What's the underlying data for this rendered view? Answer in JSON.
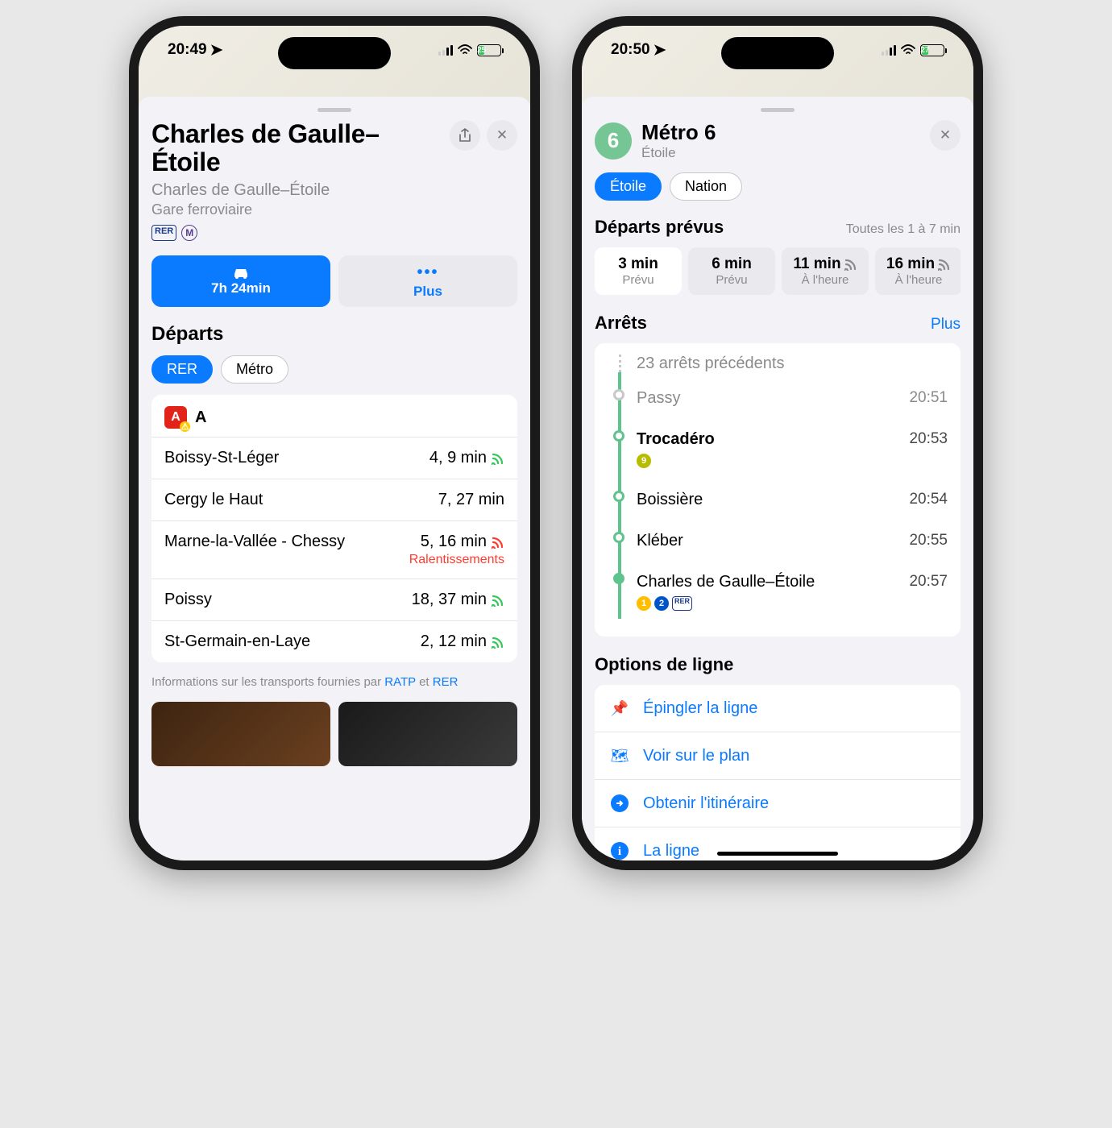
{
  "colors": {
    "accent": "#0a7aff",
    "green_line": "#5fc38e",
    "line6": "#76c695",
    "rer_a": "#e2231a",
    "warn": "#ff3b30"
  },
  "left": {
    "status": {
      "time": "20:49",
      "battery": "25"
    },
    "title": "Charles de Gaulle–Étoile",
    "subtitle_area": "Charles de Gaulle–Étoile",
    "subtitle_type": "Gare ferroviaire",
    "icons": {
      "rer": "RER",
      "metro": "M"
    },
    "actions": {
      "drive_time": "7h 24min",
      "more": "Plus"
    },
    "departures_label": "Départs",
    "tabs": {
      "rer": "RER",
      "metro": "Métro"
    },
    "line": {
      "badge": "A",
      "name": "A"
    },
    "destinations": [
      {
        "name": "Boissy-St-Léger",
        "eta": "4, 9 min",
        "live": true
      },
      {
        "name": "Cergy le Haut",
        "eta": "7, 27 min",
        "live": false
      },
      {
        "name": "Marne-la-Vallée - Chessy",
        "eta": "5, 16 min",
        "live": true,
        "status": "Ralentissements",
        "status_color": "warn"
      },
      {
        "name": "Poissy",
        "eta": "18, 37 min",
        "live": true
      },
      {
        "name": "St-Germain-en-Laye",
        "eta": "2, 12 min",
        "live": true
      }
    ],
    "info_prefix": "Informations sur les transports fournies par ",
    "info_link1": "RATP",
    "info_and": " et ",
    "info_link2": "RER"
  },
  "right": {
    "status": {
      "time": "20:50",
      "battery": "27"
    },
    "line_number": "6",
    "line_title": "Métro 6",
    "line_sub": "Étoile",
    "directions": {
      "a": "Étoile",
      "b": "Nation"
    },
    "departures": {
      "title": "Départs prévus",
      "freq": "Toutes les 1 à 7 min",
      "items": [
        {
          "min": "3 min",
          "status": "Prévu",
          "live": false,
          "active": true
        },
        {
          "min": "6 min",
          "status": "Prévu",
          "live": false
        },
        {
          "min": "11 min",
          "status": "À l'heure",
          "live": true
        },
        {
          "min": "16 min",
          "status": "À l'heure",
          "live": true
        }
      ]
    },
    "stops": {
      "title": "Arrêts",
      "more": "Plus",
      "previous": "23 arrêts précédents",
      "items": [
        {
          "name": "Passy",
          "time": "20:51",
          "grey": true
        },
        {
          "name": "Trocadéro",
          "time": "20:53",
          "bold": true,
          "conn": [
            {
              "n": "9",
              "c": "#b6bd00"
            }
          ]
        },
        {
          "name": "Boissière",
          "time": "20:54"
        },
        {
          "name": "Kléber",
          "time": "20:55"
        },
        {
          "name": "Charles de Gaulle–Étoile",
          "time": "20:57",
          "terminal": true,
          "conn": [
            {
              "n": "1",
              "c": "#ffbe00"
            },
            {
              "n": "2",
              "c": "#0055c8"
            },
            {
              "n": "RER",
              "c": "#fff",
              "rer": true
            }
          ]
        }
      ]
    },
    "options": {
      "title": "Options de ligne",
      "pin": "Épingler la ligne",
      "map": "Voir sur le plan",
      "route": "Obtenir l'itinéraire",
      "info": "La ligne"
    }
  }
}
